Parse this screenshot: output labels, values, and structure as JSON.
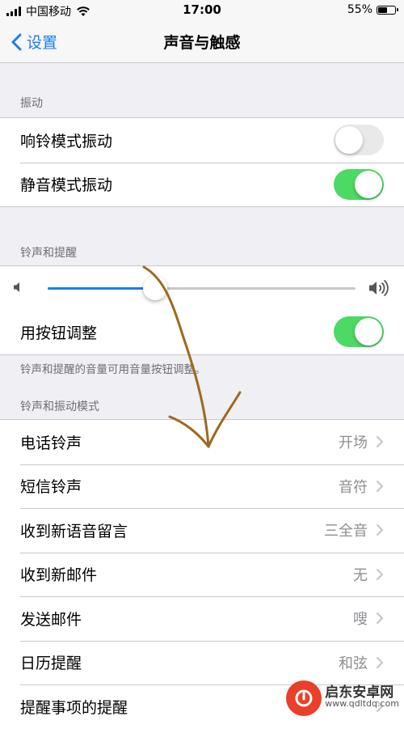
{
  "status_bar": {
    "carrier": "中国移动",
    "time": "17:00",
    "battery_percent": "55%",
    "battery_level": 0.55
  },
  "nav": {
    "back_label": "设置",
    "title": "声音与触感"
  },
  "vibration": {
    "header": "振动",
    "items": [
      {
        "label": "响铃模式振动",
        "on": false
      },
      {
        "label": "静音模式振动",
        "on": true
      }
    ]
  },
  "ringer": {
    "header": "铃声和提醒",
    "volume_level": 0.35,
    "change_with_buttons": {
      "label": "用按钮调整",
      "on": true
    },
    "footnote": "铃声和提醒的音量可用音量按钮调整。"
  },
  "patterns": {
    "header": "铃声和振动模式",
    "items": [
      {
        "label": "电话铃声",
        "value": "开场"
      },
      {
        "label": "短信铃声",
        "value": "音符"
      },
      {
        "label": "收到新语音留言",
        "value": "三全音"
      },
      {
        "label": "收到新邮件",
        "value": "无"
      },
      {
        "label": "发送邮件",
        "value": "嗖"
      },
      {
        "label": "日历提醒",
        "value": "和弦"
      },
      {
        "label": "提醒事项的提醒",
        "value": ""
      }
    ]
  },
  "watermark": {
    "brand": "启东安卓网",
    "url": "www.qdltdq.com"
  },
  "colors": {
    "accent": "#1a7cf5",
    "toggle_on": "#4cd964",
    "annotation": "#9c6a1e"
  }
}
